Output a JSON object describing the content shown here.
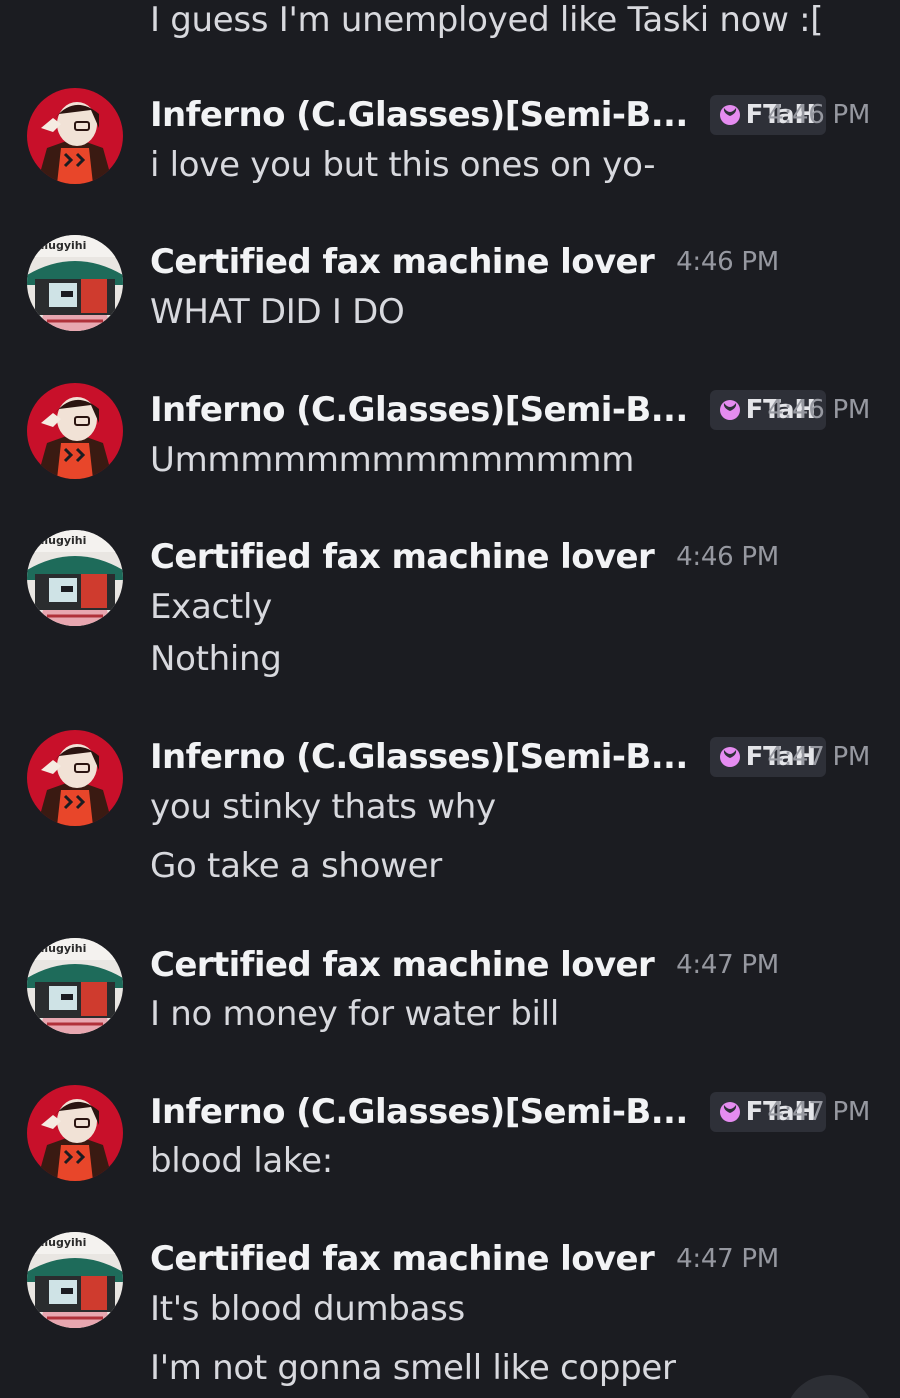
{
  "messages": [
    {
      "author": "",
      "lines": [
        "I guess I'm unemployed like Taski now :["
      ]
    },
    {
      "author": "Inferno (C.Glasses)[Semi-B...",
      "badge": "FTaH",
      "time": "4:46 PM",
      "lines": [
        "i love you but this ones on yo-"
      ]
    },
    {
      "author": "Certified fax machine lover",
      "time": "4:46 PM",
      "lines": [
        "WHAT DID I DO"
      ]
    },
    {
      "author": "Inferno (C.Glasses)[Semi-B...",
      "badge": "FTaH",
      "time": "4:46 PM",
      "lines": [
        "Ummmmmmmmmmmmmm"
      ]
    },
    {
      "author": "Certified fax machine lover",
      "time": "4:46 PM",
      "lines": [
        "Exactly",
        "Nothing"
      ]
    },
    {
      "author": "Inferno (C.Glasses)[Semi-B...",
      "badge": "FTaH",
      "time": "4:47 PM",
      "lines": [
        "you stinky thats why",
        "Go take a shower"
      ]
    },
    {
      "author": "Certified fax machine lover",
      "time": "4:47 PM",
      "lines": [
        "I no money for water bill"
      ]
    },
    {
      "author": "Inferno (C.Glasses)[Semi-B...",
      "badge": "FTaH",
      "time": "4:47 PM",
      "lines": [
        "blood lake:"
      ]
    },
    {
      "author": "Certified fax machine lover",
      "time": "4:47 PM",
      "lines": [
        "It's blood dumbass",
        "I'm not gonna smell like copper"
      ]
    }
  ],
  "avatar_text": "ohiugyihi",
  "colors": {
    "background": "#1b1c21",
    "badge_bg": "#2e3038",
    "badge_icon": "#e58cf0",
    "timestamp": "#9698a0",
    "name": "#f2f3f5",
    "message": "#d8d9de"
  }
}
